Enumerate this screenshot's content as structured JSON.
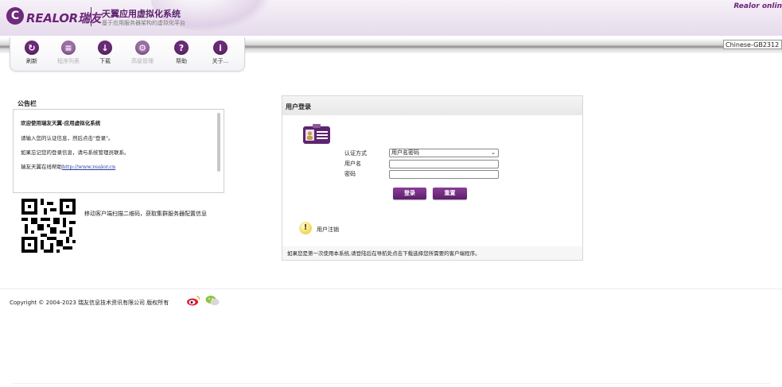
{
  "header": {
    "logo_mark": "C",
    "logo_text": "REALOR瑞友",
    "title": "天翼应用虚拟化系统",
    "subtitle": "基于应用服务器架构的虚拟化平台",
    "online_text": "Realor onlin"
  },
  "language": {
    "selected": "Chinese-GB2312 ⌄"
  },
  "toolbar": {
    "items": [
      {
        "label": "刷新",
        "icon": "refresh-icon",
        "glyph": "↻",
        "enabled": true
      },
      {
        "label": "程序列表",
        "icon": "program-list-icon",
        "glyph": "≡",
        "enabled": false
      },
      {
        "label": "下载",
        "icon": "download-icon",
        "glyph": "↓",
        "enabled": true
      },
      {
        "label": "高级管理",
        "icon": "admin-icon",
        "glyph": "⚙",
        "enabled": false
      },
      {
        "label": "帮助",
        "icon": "help-icon",
        "glyph": "?",
        "enabled": true
      },
      {
        "label": "关于...",
        "icon": "about-icon",
        "glyph": "i",
        "enabled": true
      }
    ]
  },
  "bulletin": {
    "title": "公告栏",
    "lines": [
      "欢迎使用瑞友天翼-应用虚拟化系统",
      "请输入您的认证信息，然后点击\"登录\"。",
      "如果忘记您的登录信息，请与系统管理员联系。"
    ],
    "help_prefix": "瑞友天翼在线帮助",
    "help_link": "http://www.realor.cn",
    "qr_caption": "移动客户端扫描二维码，获取集群服务器配置信息"
  },
  "login": {
    "title": "用户登录",
    "auth_label": "认证方式",
    "auth_value": "用户名密码",
    "username_label": "用户名",
    "password_label": "密码",
    "username_value": "",
    "password_value": "",
    "login_button": "登录",
    "reset_button": "重置",
    "logout_label": "用户注销",
    "note": "如果您是第一次使用本系统,请登陆后在导航处点击下载选择您所需要的客户端程序。"
  },
  "footer": {
    "copyright": "Copyright © 2004-2023 瑞友信息技术资讯有限公司 版权所有"
  },
  "colors": {
    "brand": "#6b2479",
    "button": "#6d2c7b"
  }
}
